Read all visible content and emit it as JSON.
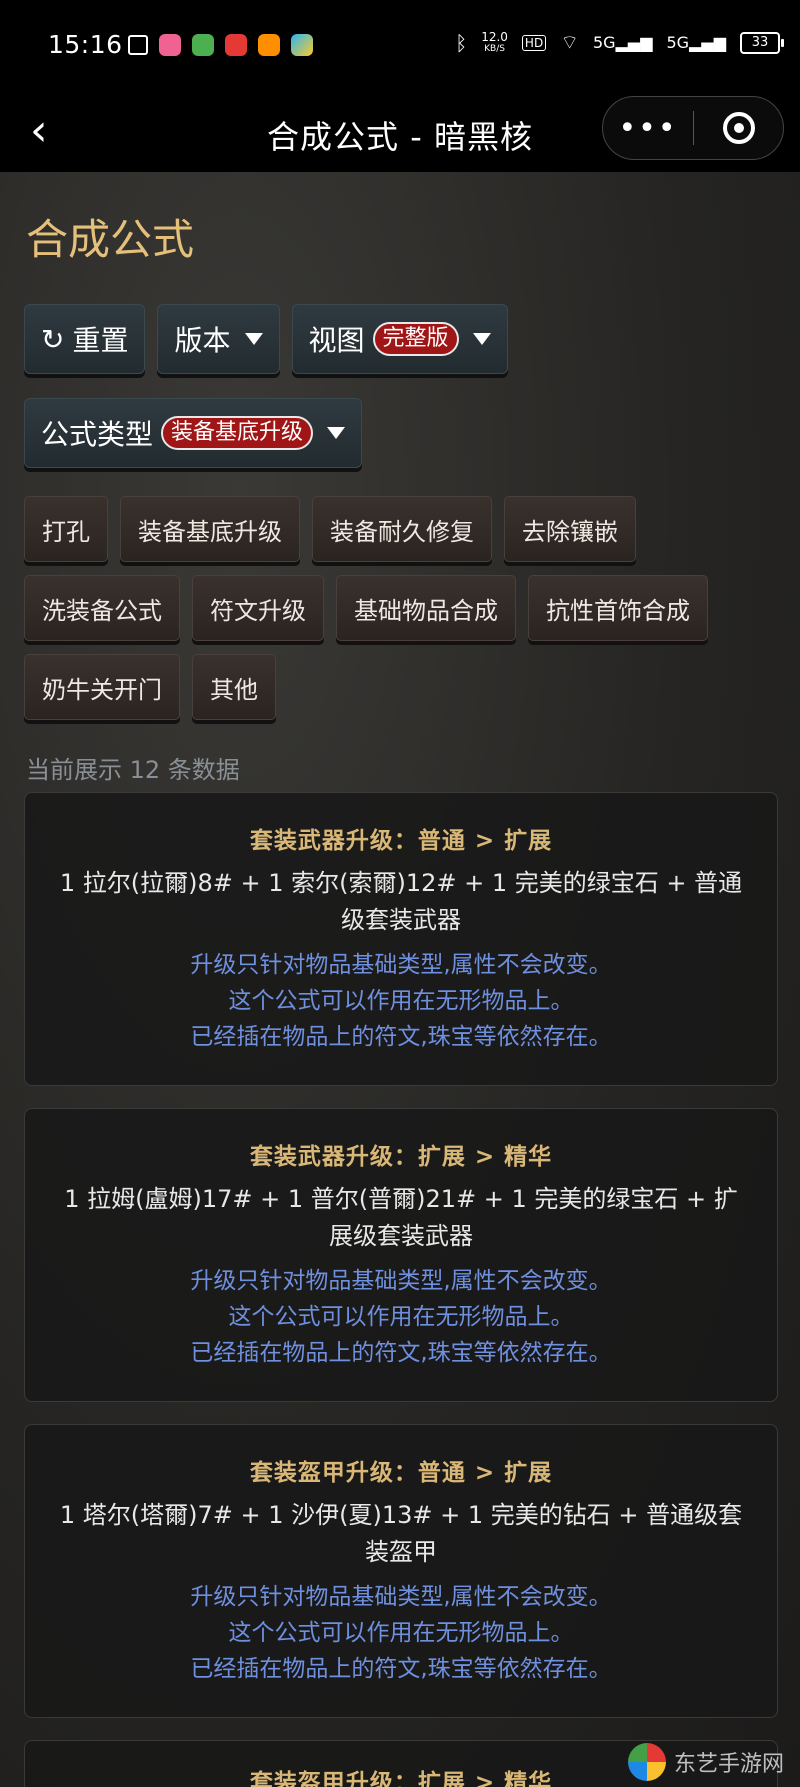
{
  "status_bar": {
    "time": "15:16",
    "speed_value": "12.0",
    "speed_unit": "KB/S",
    "hd_label": "HD",
    "network_1": "5G",
    "network_2": "5G",
    "battery": "33"
  },
  "nav": {
    "title": "合成公式 - 暗黑核",
    "more": "•••"
  },
  "page_title": "合成公式",
  "controls": {
    "reset": "重置",
    "version": "版本",
    "view": "视图",
    "view_value": "完整版",
    "formula_type": "公式类型",
    "formula_type_value": "装备基底升级"
  },
  "categories": [
    "打孔",
    "装备基底升级",
    "装备耐久修复",
    "去除镶嵌",
    "洗装备公式",
    "符文升级",
    "基础物品合成",
    "抗性首饰合成",
    "奶牛关开门",
    "其他"
  ],
  "count_text": "当前展示 12 条数据",
  "cards": [
    {
      "title": "套装武器升级：普通 > 扩展",
      "formula": "1 拉尔(拉爾)8# + 1 索尔(索爾)12# + 1 完美的绿宝石 + 普通级套装武器",
      "notes": [
        "升级只针对物品基础类型,属性不会改变。",
        "这个公式可以作用在无形物品上。",
        "已经插在物品上的符文,珠宝等依然存在。"
      ]
    },
    {
      "title": "套装武器升级：扩展 > 精华",
      "formula": "1 拉姆(盧姆)17# + 1 普尔(普爾)21# + 1 完美的绿宝石 + 扩展级套装武器",
      "notes": [
        "升级只针对物品基础类型,属性不会改变。",
        "这个公式可以作用在无形物品上。",
        "已经插在物品上的符文,珠宝等依然存在。"
      ]
    },
    {
      "title": "套装盔甲升级：普通 > 扩展",
      "formula": "1 塔尔(塔爾)7# + 1 沙伊(夏)13# + 1 完美的钻石 + 普通级套装盔甲",
      "notes": [
        "升级只针对物品基础类型,属性不会改变。",
        "这个公式可以作用在无形物品上。",
        "已经插在物品上的符文,珠宝等依然存在。"
      ]
    },
    {
      "title": "套装盔甲升级：扩展 > 精华"
    }
  ],
  "watermark": "东艺手游网"
}
